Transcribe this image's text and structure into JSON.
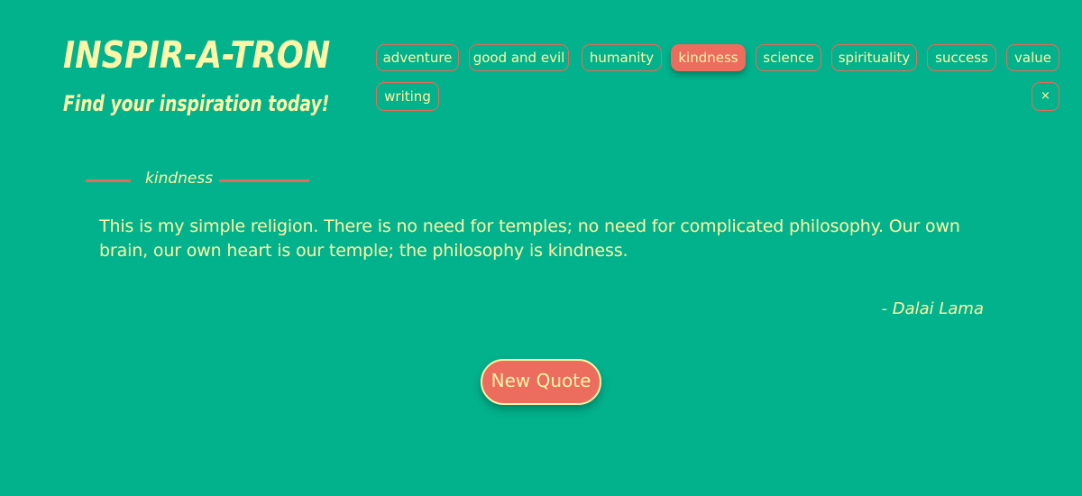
{
  "brand": {
    "title": "INSPIR-A-TRON",
    "tagline": "Find your inspiration today!"
  },
  "tags": {
    "items": [
      {
        "label": "adventure",
        "active": false
      },
      {
        "label": "good and evil",
        "active": false
      },
      {
        "label": "humanity",
        "active": false
      },
      {
        "label": "kindness",
        "active": true
      },
      {
        "label": "science",
        "active": false
      },
      {
        "label": "spirituality",
        "active": false
      },
      {
        "label": "success",
        "active": false
      },
      {
        "label": "value",
        "active": false
      },
      {
        "label": "writing",
        "active": false
      }
    ],
    "clear_label": "×",
    "clear_icon": "close-icon"
  },
  "quote": {
    "category": "kindness",
    "text": "This is my simple religion. There is no need for temples; no need for complicated philosophy. Our own brain, our own heart is our temple; the philosophy is kindness.",
    "author": "- Dalai Lama"
  },
  "actions": {
    "new_quote_label": "New Quote"
  },
  "colors": {
    "background": "#02b28c",
    "accent": "#ec6c5d",
    "text": "#fff7a8"
  }
}
